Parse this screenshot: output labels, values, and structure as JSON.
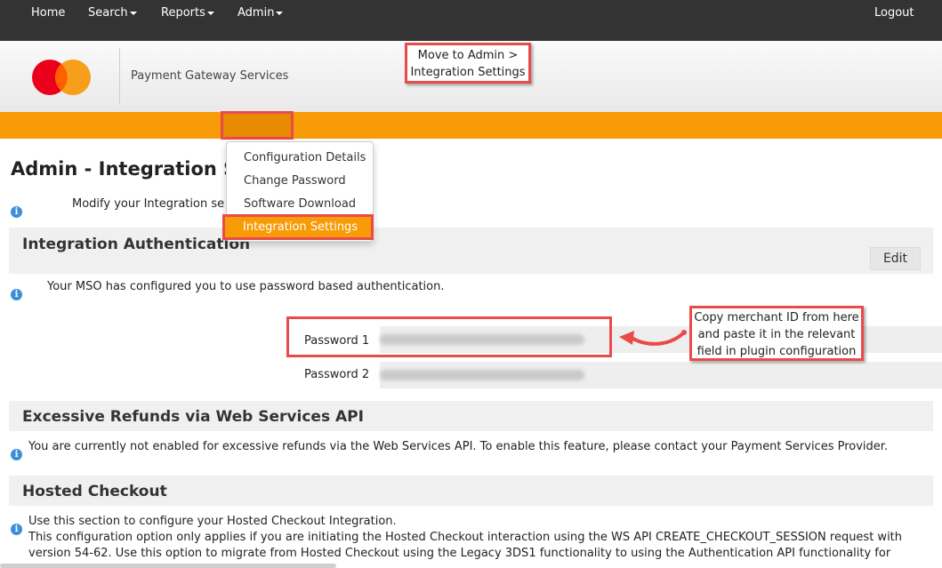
{
  "header": {
    "brand": "Payment Gateway Services"
  },
  "annotations": {
    "top_callout": [
      "Move to Admin >",
      "Integration Settings"
    ],
    "right_callout": [
      "Copy merchant ID from here",
      "and paste it in the relevant",
      "field in plugin configuration"
    ],
    "highlight_color": "#e94b4b"
  },
  "nav": {
    "home": "Home",
    "search": "Search",
    "reports": "Reports",
    "admin": "Admin",
    "logout": "Logout",
    "bar_color": "#f79b06"
  },
  "dropdown": {
    "items": [
      "Configuration Details",
      "Change Password",
      "Software Download",
      "Integration Settings"
    ],
    "selected": "Integration Settings"
  },
  "page": {
    "title": "Admin - Integration S",
    "intro": "Modify your Integration se"
  },
  "integration_auth": {
    "title": "Integration Authentication",
    "edit_label": "Edit",
    "note": "Your MSO has configured you to use password based authentication.",
    "password1_label": "Password 1",
    "password2_label": "Password 2"
  },
  "excessive_refunds": {
    "title": "Excessive Refunds via Web Services API",
    "note": "You are currently not enabled for excessive refunds via the Web Services API. To enable this feature, please contact your Payment Services Provider."
  },
  "hosted_checkout": {
    "title": "Hosted Checkout",
    "line1": "Use this section to configure your Hosted Checkout Integration.",
    "line2": "This configuration option only applies if you are initiating the Hosted Checkout interaction using the WS API CREATE_CHECKOUT_SESSION request with",
    "line3": "version 54-62. Use this option to migrate from Hosted Checkout using the Legacy 3DS1 functionality to using the Authentication API functionality for"
  },
  "icons": {
    "info": "info-icon",
    "logo": "mastercard-logo",
    "caret": "caret-down-icon",
    "arrow": "curved-arrow-icon"
  }
}
